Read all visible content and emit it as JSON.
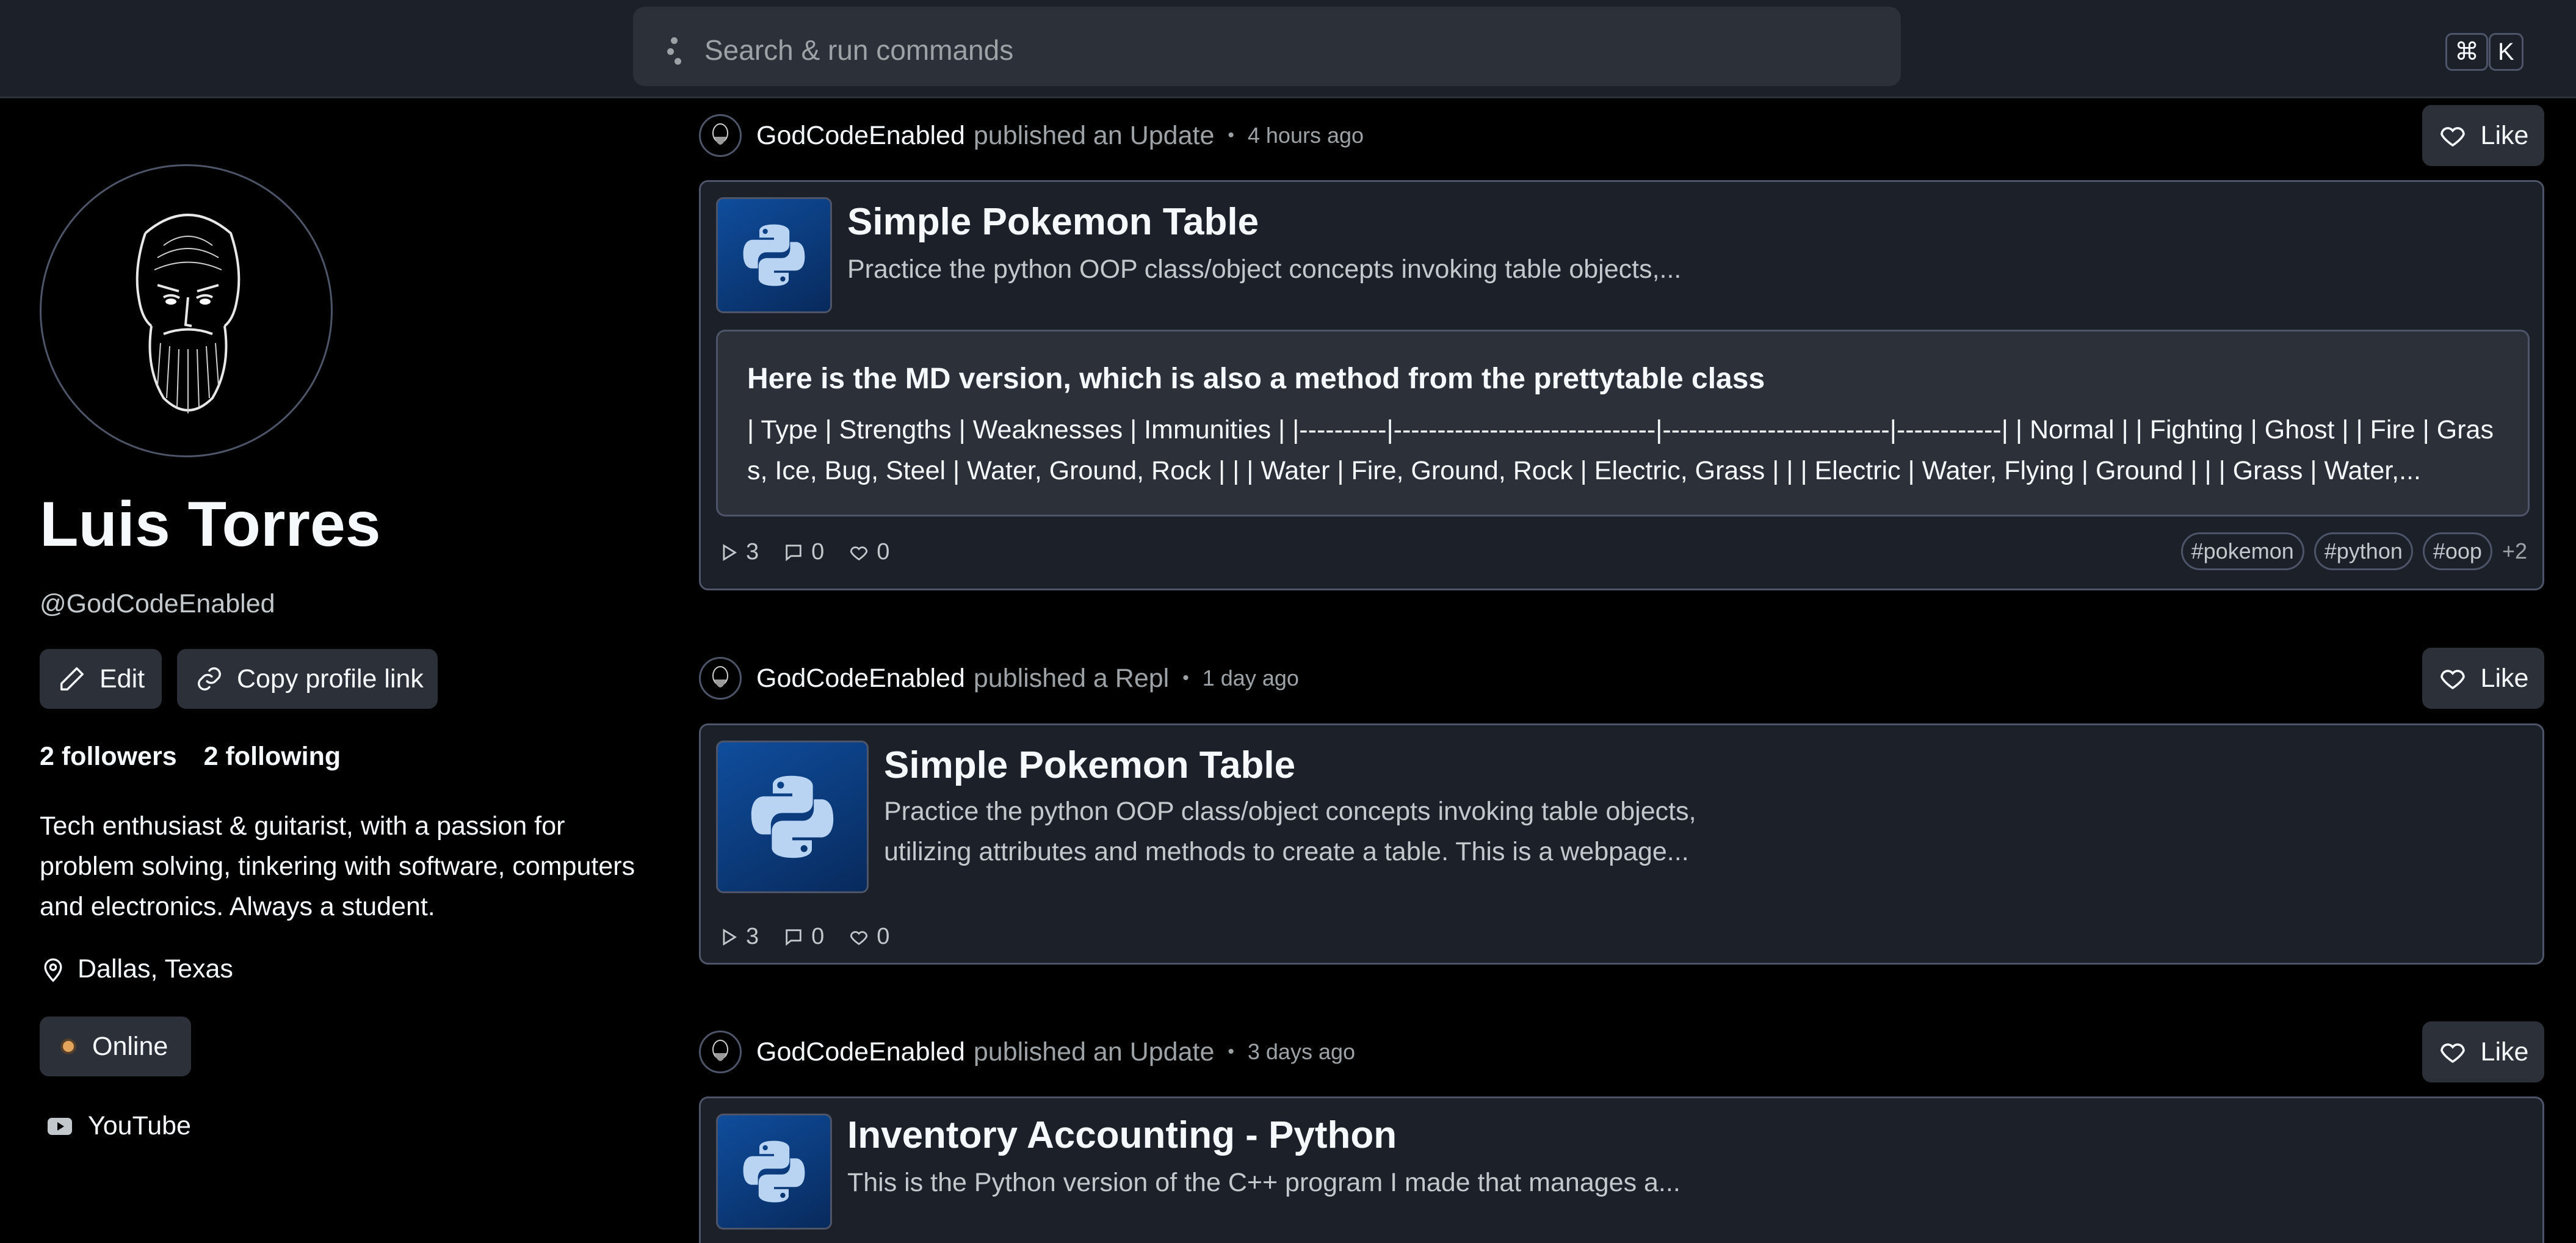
{
  "search": {
    "placeholder": "Search & run commands",
    "shortcut_mod": "⌘",
    "shortcut_key": "K"
  },
  "profile": {
    "name": "Luis Torres",
    "handle": "@GodCodeEnabled",
    "edit_label": "Edit",
    "copy_link_label": "Copy profile link",
    "followers": "2 followers",
    "following": "2 following",
    "bio": "Tech enthusiast & guitarist, with a passion for problem solving, tinkering with software, computers and electronics. Always a student.",
    "location": "Dallas, Texas",
    "status": "Online",
    "social_link": "YouTube"
  },
  "posts": [
    {
      "user": "GodCodeEnabled",
      "action": "published an Update",
      "time": "4 hours ago",
      "like_label": "Like",
      "title": "Simple Pokemon Table",
      "description": "Practice the python OOP class/object concepts invoking table objects,...",
      "md_title": "Here is the MD version, which is also a method from the prettytable class",
      "md_body": "| Type | Strengths | Weaknesses | Immunities | |----------|------------------------------|--------------------------|------------| | Normal | | Fighting | Ghost | | Fire | Grass, Ice, Bug, Steel | Water, Ground, Rock | | | Water | Fire, Ground, Rock | Electric, Grass | | | Electric | Water, Flying | Ground | | | Grass | Water,...",
      "runs": "3",
      "comments": "0",
      "likes": "0",
      "tags": [
        "#pokemon",
        "#python",
        "#oop"
      ],
      "more_tags": "+2"
    },
    {
      "user": "GodCodeEnabled",
      "action": "published a Repl",
      "time": "1 day ago",
      "like_label": "Like",
      "title": "Simple Pokemon Table",
      "description": "Practice the python OOP class/object concepts invoking table objects, utilizing attributes and methods to create a table. This is a webpage...",
      "runs": "3",
      "comments": "0",
      "likes": "0"
    },
    {
      "user": "GodCodeEnabled",
      "action": "published an Update",
      "time": "3 days ago",
      "like_label": "Like",
      "title": "Inventory Accounting - Python",
      "description": "This is the Python version of the C++ program I made that manages a..."
    }
  ]
}
